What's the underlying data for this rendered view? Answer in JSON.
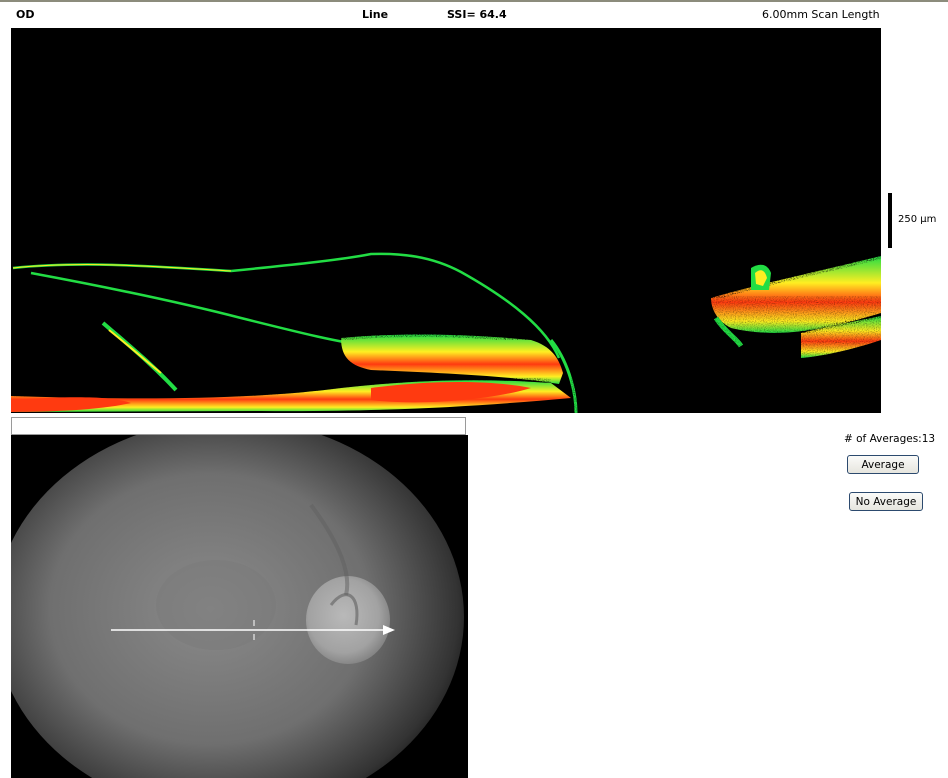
{
  "header": {
    "eye": "OD",
    "scan_type": "Line",
    "ssi": "SSI= 64.4",
    "scan_length": "6.00mm Scan Length"
  },
  "scale": {
    "label": "250 µm"
  },
  "averages": {
    "label": "# of Averages:13",
    "average_button": "Average",
    "no_average_button": "No Average"
  },
  "colors": {
    "oct_background": "#000000",
    "oct_low": "#1f3cff",
    "oct_mid": "#22dd44",
    "oct_high": "#ffee22",
    "oct_peak": "#ff3a10",
    "scan_line": "#ffffff"
  },
  "icons": {
    "scan_arrow": "arrow-right-icon",
    "fovea_marker": "crosshair-icon"
  }
}
